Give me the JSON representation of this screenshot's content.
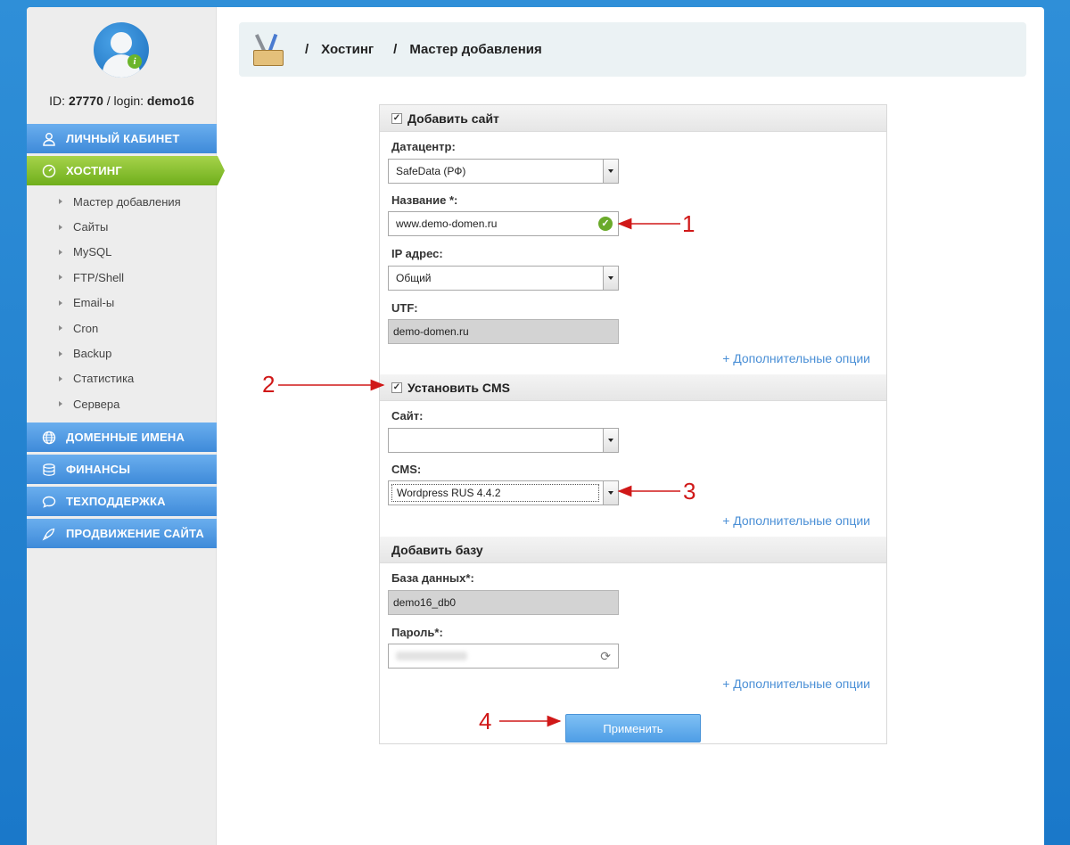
{
  "user": {
    "id_prefix": "ID: ",
    "id": "27770",
    "login_prefix": " / login: ",
    "login": "demo16"
  },
  "nav": {
    "cabinet": "Личный кабинет",
    "hosting": "Хостинг",
    "hosting_sub": [
      "Мастер добавления",
      "Сайты",
      "MySQL",
      "FTP/Shell",
      "Email-ы",
      "Cron",
      "Backup",
      "Статистика",
      "Сервера"
    ],
    "domains": "Доменные имена",
    "finance": "Финансы",
    "support": "Техподдержка",
    "promo": "Продвижение сайта"
  },
  "breadcrumb": {
    "sep": "/",
    "items": [
      "Хостинг",
      "Мастер добавления"
    ]
  },
  "form": {
    "add_site": {
      "title": "Добавить сайт",
      "checked": true,
      "datacenter_label": "Датацентр:",
      "datacenter_value": "SafeData (РФ)",
      "name_label": "Название *:",
      "name_value": "www.demo-domen.ru",
      "ip_label": "IP адрес:",
      "ip_value": "Общий",
      "utf_label": "UTF:",
      "utf_value": "demo-domen.ru",
      "more": "+ Дополнительные опции"
    },
    "install_cms": {
      "title": "Установить CMS",
      "checked": true,
      "site_label": "Сайт:",
      "site_value": "",
      "cms_label": "CMS:",
      "cms_value": "Wordpress RUS 4.4.2",
      "more": "+ Дополнительные опции"
    },
    "add_db": {
      "title": "Добавить базу",
      "db_label": "База данных*:",
      "db_value": "demo16_db0",
      "password_label": "Пароль*:",
      "more": "+ Дополнительные опции"
    },
    "apply": "Применить"
  },
  "annotations": [
    "1",
    "2",
    "3",
    "4"
  ],
  "colors": {
    "nav_blue": "#4a95de",
    "nav_active_green": "#82bd2c",
    "link": "#4a8fd6",
    "annotation_red": "#d01818"
  }
}
